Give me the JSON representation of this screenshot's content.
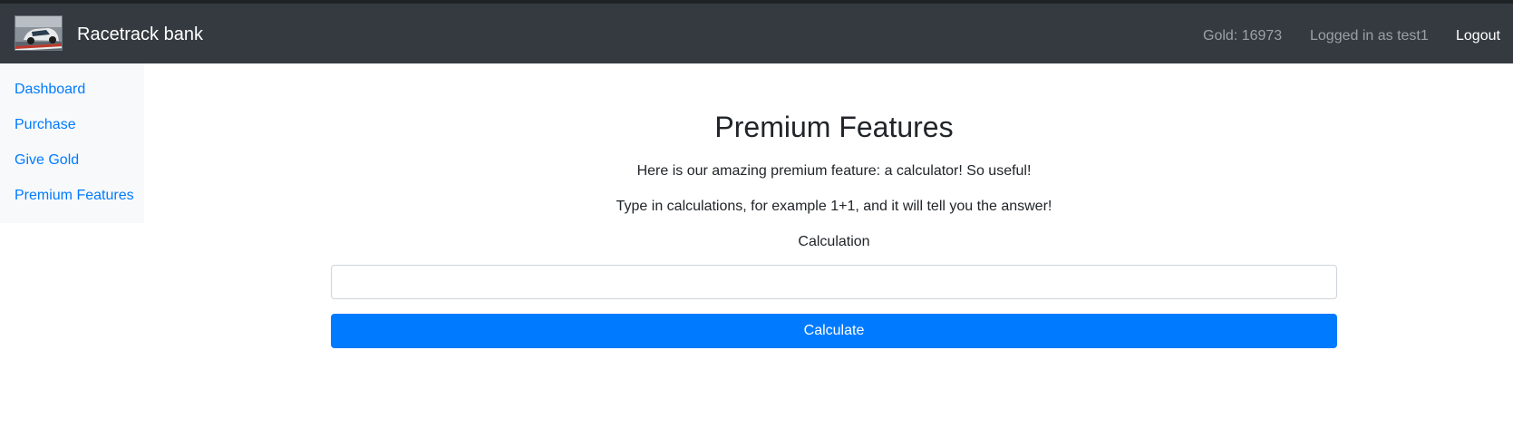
{
  "navbar": {
    "brand_name": "Racetrack bank",
    "logo_icon": "race-car-logo-icon",
    "gold_text": "Gold: 16973",
    "logged_in_text": "Logged in as test1",
    "logout_label": "Logout"
  },
  "sidebar": {
    "items": [
      {
        "label": "Dashboard"
      },
      {
        "label": "Purchase"
      },
      {
        "label": "Give Gold"
      },
      {
        "label": "Premium Features"
      }
    ]
  },
  "main": {
    "title": "Premium Features",
    "description_1": "Here is our amazing premium feature: a calculator! So useful!",
    "description_2": "Type in calculations, for example 1+1, and it will tell you the answer!",
    "field_label": "Calculation",
    "input_value": "",
    "button_label": "Calculate"
  },
  "colors": {
    "navbar_bg": "#343a40",
    "link": "#007bff",
    "button_bg": "#007bff",
    "sidebar_bg": "#f8f9fa"
  }
}
